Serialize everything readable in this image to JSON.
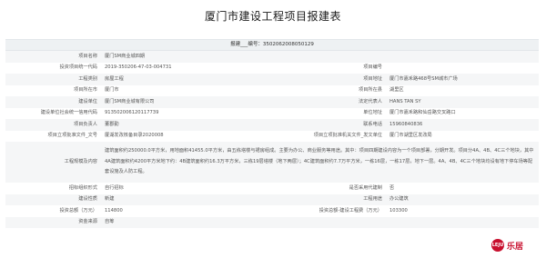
{
  "title": "厦门市建设工程项目报建表",
  "report_no": {
    "label": "报建",
    "sep": "编号",
    "value": "3502062008050129"
  },
  "rows": [
    {
      "type": "full",
      "l1": "项目名称",
      "v1": "厦门SM商业城四期"
    },
    {
      "type": "pair",
      "l1": "投资项目统一代码",
      "v1": "2019-350206-47-03-004731",
      "l2": "项目编号",
      "v2": ""
    },
    {
      "type": "pair",
      "l1": "工程类别",
      "v1": "房屋工程",
      "l2": "项目地址",
      "v2": "厦门市嘉禾路468号SM城市广场"
    },
    {
      "type": "pair",
      "l1": "项目所在市",
      "v1": "厦门市",
      "l2": "项目所在县",
      "v2": "湖里区"
    },
    {
      "type": "pair",
      "l1": "建设单位",
      "v1": "厦门SM商业城有限公司",
      "l2": "法定代表人",
      "v2": "HANS TAN SY"
    },
    {
      "type": "pair",
      "l1": "建设单位社会统一信用代码",
      "v1": "913502006120117739",
      "l2": "单位地址",
      "v2": "厦门市嘉禾路和仙岳路交叉路口"
    },
    {
      "type": "pair",
      "l1": "项目负责人",
      "v1": "董郡勤",
      "l2": "联系电话",
      "v2": "15960840836"
    },
    {
      "type": "pair",
      "l1": "项目立项批准文件_文号",
      "v1": "厦湖发改核备目录2020008",
      "l2": "项目立项批准机关文件_发文单位",
      "v2": "厦门市湖里区发改局"
    },
    {
      "type": "tall",
      "l1": "工程规模及内容",
      "v1": "建筑面积约250000.0平方米，用地面积41455.0平方米，由五栋塔楼与裙房组成。主要为办公、商业服务等用途。其中：项目四期建设内容为一个项目部署，分期开发。项目分4A、4B、4C三个地块，其中4A建筑面积约4200平方米地下约：4B建筑面积约16.3万平方米，三栋19层塔楼（地下两层）；4C建筑面积约7.7万平方米，一栋16层，一栋17层，地下一层。4A、4B、4C三个地块均设有地下停车场等配套设施及人防工程。"
    },
    {
      "type": "pair",
      "l1": "招标组织形式",
      "v1": "自行招标",
      "l2": "是否采用代建制",
      "v2": "否"
    },
    {
      "type": "pair",
      "l1": "建设性质",
      "v1": "新建",
      "l2": "工程用途",
      "v2": "办公建筑"
    },
    {
      "type": "pair",
      "l1": "投资总额（万元）",
      "v1": "114800",
      "l2": "投资总额-建设工程费（万元）",
      "v2": "103300"
    },
    {
      "type": "full",
      "l1": "资金来源",
      "v1": "自筹"
    }
  ],
  "logo": {
    "circle_text": "LEJU",
    "name": "乐居"
  }
}
